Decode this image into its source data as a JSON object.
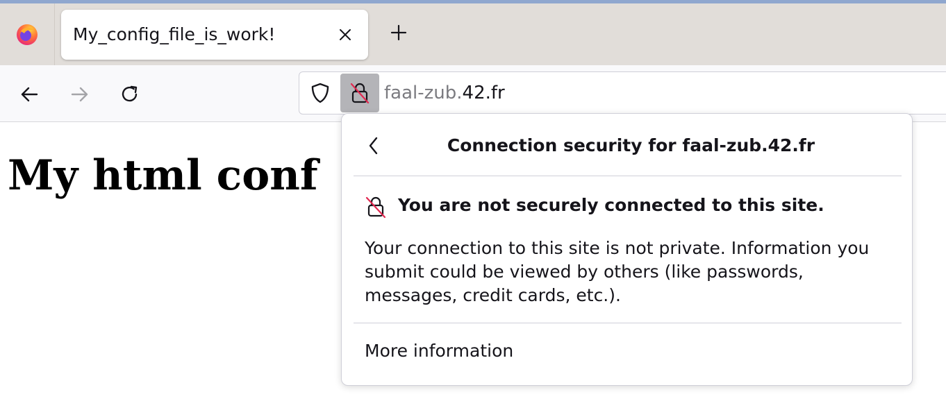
{
  "browser": {
    "tab": {
      "title": "My_config_file_is_work!"
    },
    "urlbar": {
      "subdomain": "faal-zub.",
      "domain": "42.fr"
    }
  },
  "page": {
    "heading": "My html conf"
  },
  "security_panel": {
    "title": "Connection security for faal-zub.42.fr",
    "warning": "You are not securely connected to this site.",
    "description": "Your connection to this site is not private. Information you submit could be viewed by others (like passwords, messages, credit cards, etc.).",
    "more_info": "More information"
  },
  "colors": {
    "tabstrip_bg": "#e1ddd9",
    "navbar_bg": "#f9f9fb",
    "insecure_slash": "#e22850",
    "accent_topline": "#8fa7cf"
  },
  "icons": {
    "browser_logo": "firefox-logo-icon",
    "close_tab": "close-icon",
    "new_tab": "plus-icon",
    "back": "arrow-left-icon",
    "forward": "arrow-right-icon",
    "reload": "reload-icon",
    "tracking": "shield-icon",
    "insecure": "insecure-lock-icon",
    "panel_back": "chevron-left-icon"
  }
}
